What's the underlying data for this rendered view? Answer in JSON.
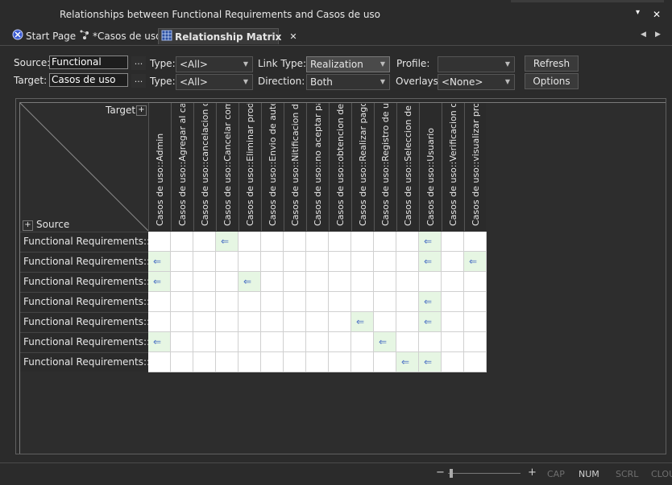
{
  "window": {
    "title": "Relationships between Functional Requirements and Casos de uso",
    "pin_glyph": "▾",
    "close_glyph": "✕"
  },
  "tabs": [
    {
      "label": "Start Page",
      "icon": "start-page-icon"
    },
    {
      "label": "*Casos de uso",
      "icon": "diagram-icon"
    },
    {
      "label": "Relationship Matrix",
      "icon": "matrix-icon",
      "active": true
    }
  ],
  "tab_nav": {
    "prev": "◀",
    "next": "▶",
    "close": "✕"
  },
  "toolbar": {
    "source_label": "Source:",
    "source_value": "Functional",
    "target_label": "Target:",
    "target_value": "Casos de uso",
    "ellipsis": "...",
    "type_label": "Type:",
    "source_type": "<All>",
    "target_type": "<All>",
    "link_type_label": "Link Type:",
    "link_type": "Realization",
    "direction_label": "Direction:",
    "direction": "Both",
    "profile_label": "Profile:",
    "profile": "",
    "overlays_label": "Overlays:",
    "overlays": "<None>",
    "refresh_label": "Refresh",
    "options_label": "Options"
  },
  "matrix": {
    "target_header": "Target",
    "source_header": "Source",
    "plus": "+",
    "arrow_glyph": "⇐",
    "columns": [
      "Casos de uso::Admin",
      "Casos de uso::Agregar al carrito",
      "Casos de uso::cancelacion de pedido",
      "Casos de uso::Cancelar compra",
      "Casos de uso::Eliminar producto",
      "Casos de uso::Envio de autenticacion",
      "Casos de uso::Nitificacion de compra",
      "Casos de uso::no aceptar pagos",
      "Casos de uso::obtencion de datos",
      "Casos de uso::Realizar pagos",
      "Casos de uso::Registro de usuario",
      "Casos de uso::Seleccion de producto",
      "Casos de uso::Usuario",
      "Casos de uso::Verificacion compra",
      "Casos de uso::visualizar producto"
    ],
    "rows": [
      {
        "label": "Functional Requirements::...",
        "marks": [
          3,
          12
        ]
      },
      {
        "label": "Functional Requirements::...",
        "marks": [
          0,
          12,
          14
        ]
      },
      {
        "label": "Functional Requirements::...",
        "marks": [
          0,
          4
        ]
      },
      {
        "label": "Functional Requirements::I...",
        "marks": [
          12
        ]
      },
      {
        "label": "Functional Requirements::...",
        "marks": [
          9,
          12
        ]
      },
      {
        "label": "Functional Requirements::...",
        "marks": [
          0,
          10
        ]
      },
      {
        "label": "Functional Requirements::...",
        "marks": [
          11,
          12
        ]
      }
    ]
  },
  "statusbar": {
    "zoom_minus": "−",
    "zoom_plus": "+",
    "indicators": [
      {
        "label": "CAP",
        "active": false
      },
      {
        "label": "NUM",
        "active": true
      },
      {
        "label": "SCRL",
        "active": false
      },
      {
        "label": "CLOU",
        "active": false
      }
    ]
  }
}
